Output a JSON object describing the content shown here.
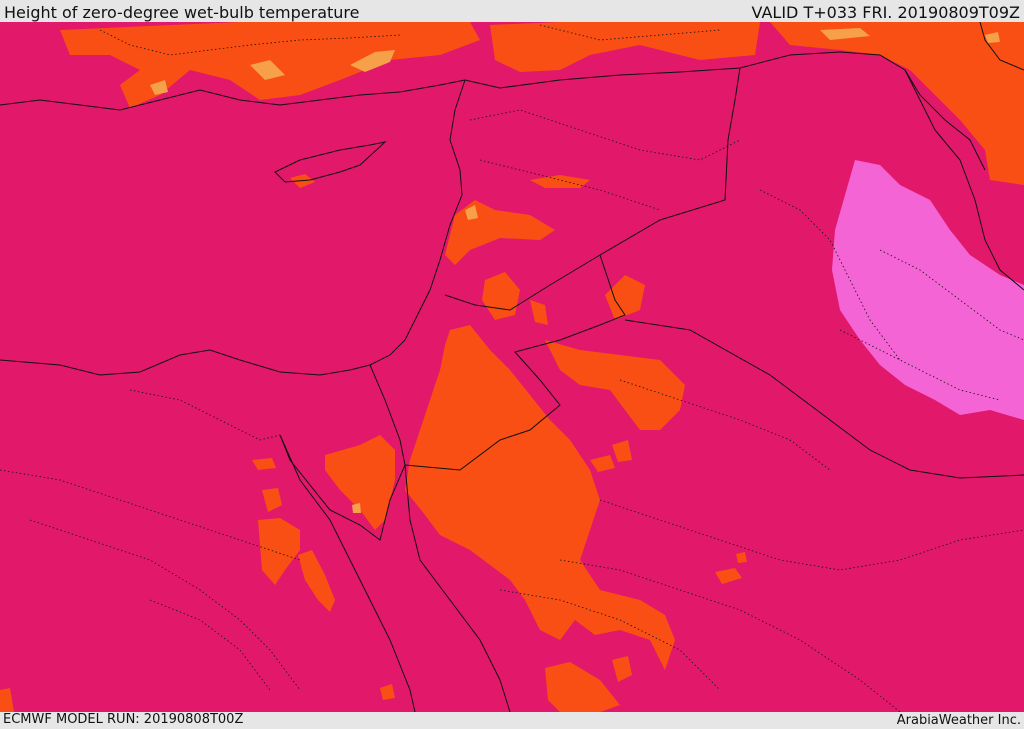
{
  "header": {
    "title": "Height of zero-degree wet-bulb temperature",
    "valid": "VALID T+033 FRI. 20190809T09Z"
  },
  "footer": {
    "model_run": "ECMWF MODEL RUN: 20190808T00Z",
    "credit": "ArabiaWeather Inc."
  },
  "colors": {
    "base": "#e2186b",
    "orange": "#f94f14",
    "light_orange": "#f7a04a",
    "pink": "#f564d4",
    "border": "#111111",
    "bar_background": "#e6e6e6"
  }
}
